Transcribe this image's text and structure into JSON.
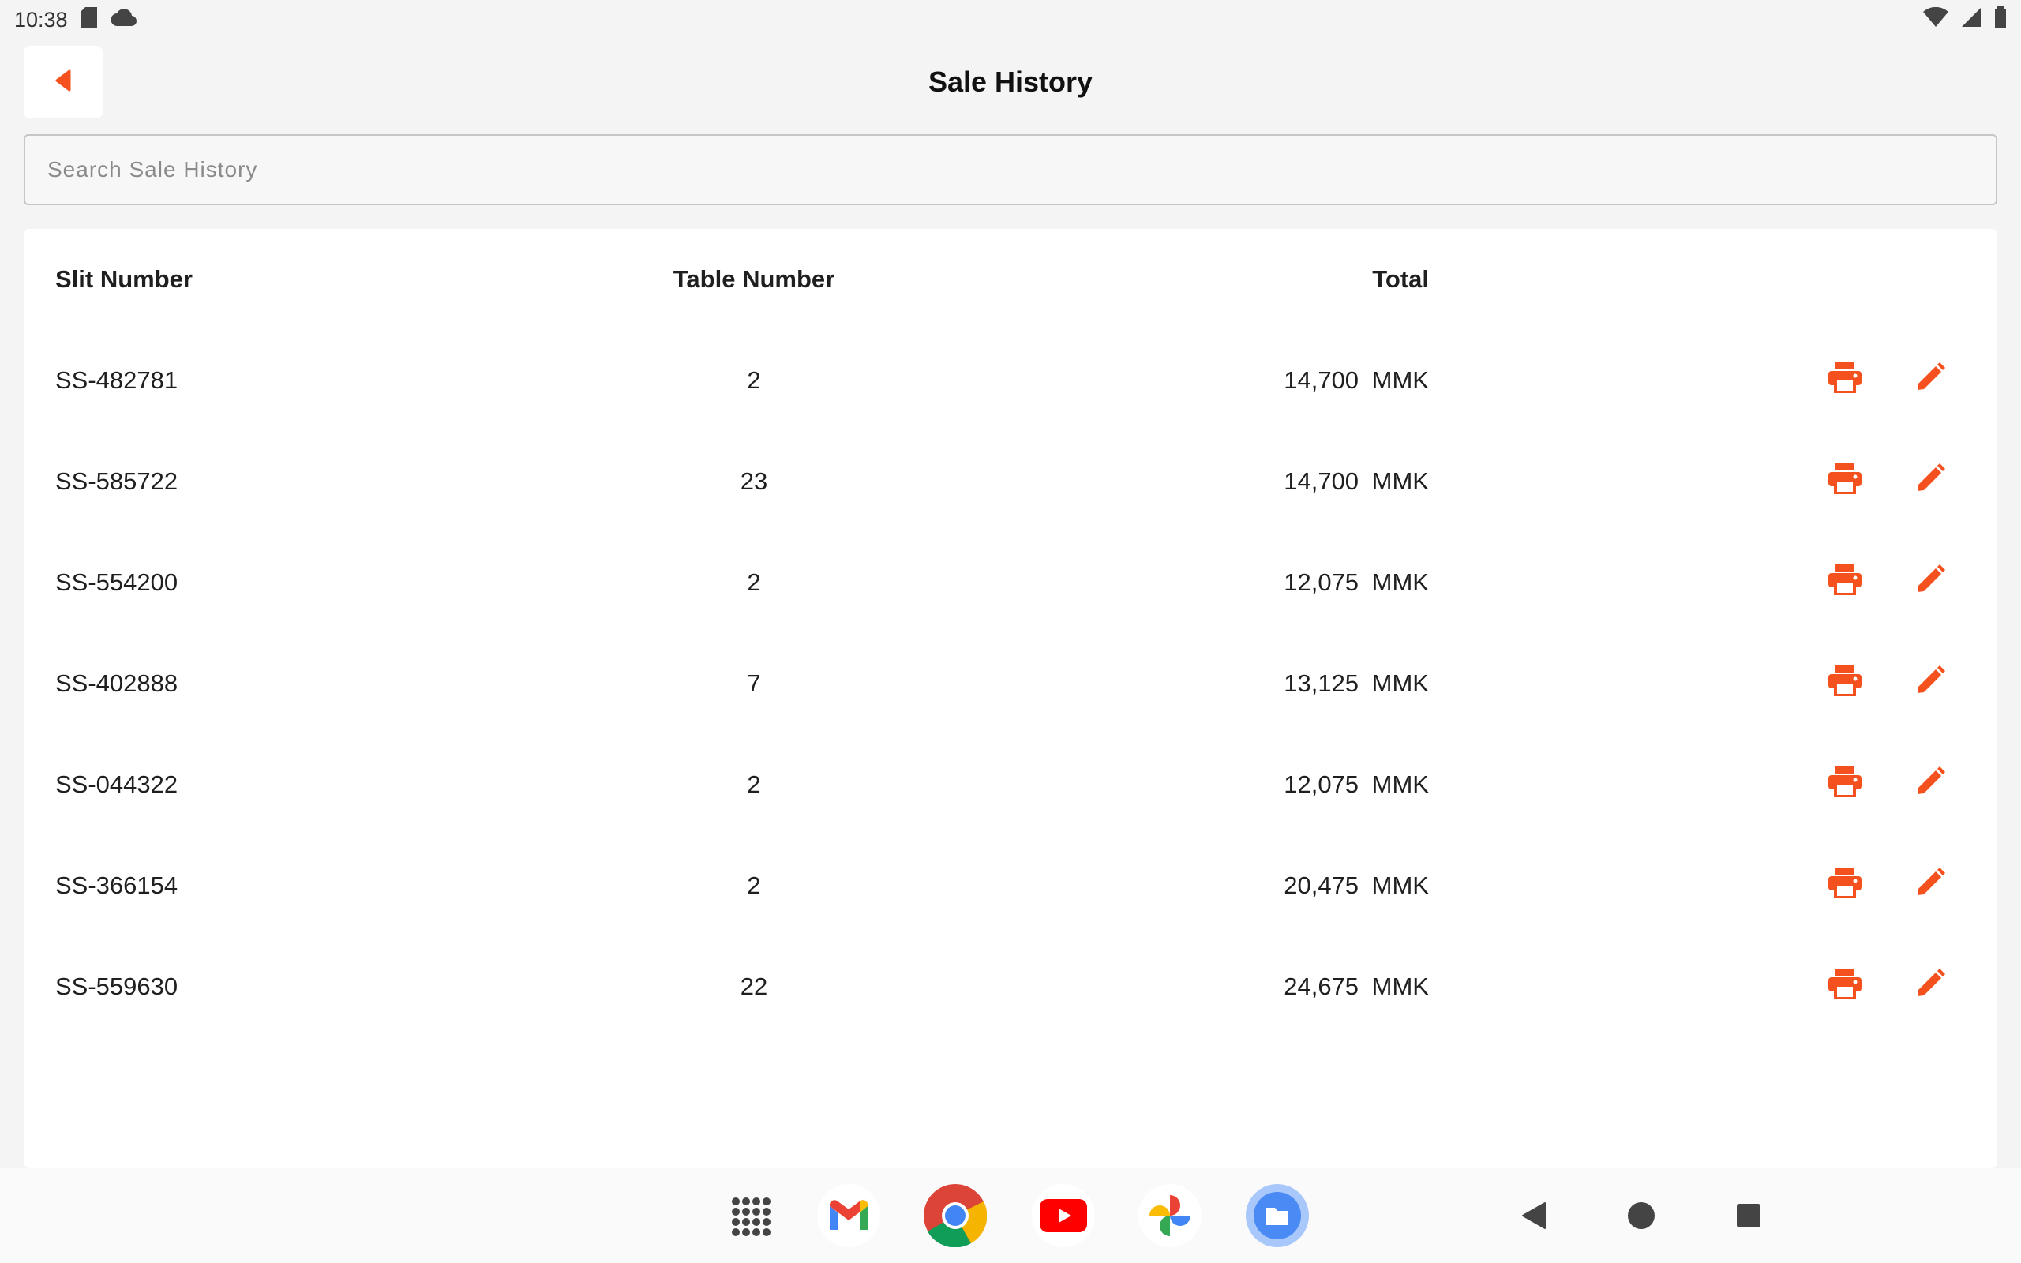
{
  "status_bar": {
    "time": "10:38"
  },
  "header": {
    "title": "Sale History",
    "back_icon": "back-arrow-icon"
  },
  "search": {
    "placeholder": "Search Sale History",
    "value": ""
  },
  "table": {
    "columns": [
      "Slit Number",
      "Table Number",
      "Total"
    ],
    "rows": [
      {
        "slit": "SS-482781",
        "table": "2",
        "total": "14,700 MMK"
      },
      {
        "slit": "SS-585722",
        "table": "23",
        "total": "14,700 MMK"
      },
      {
        "slit": "SS-554200",
        "table": "2",
        "total": "12,075 MMK"
      },
      {
        "slit": "SS-402888",
        "table": "7",
        "total": "13,125 MMK"
      },
      {
        "slit": "SS-044322",
        "table": "2",
        "total": "12,075 MMK"
      },
      {
        "slit": "SS-366154",
        "table": "2",
        "total": "20,475 MMK"
      },
      {
        "slit": "SS-559630",
        "table": "22",
        "total": "24,675 MMK"
      }
    ],
    "row_actions": [
      "print-icon",
      "edit-icon"
    ]
  },
  "dock": {
    "apps": [
      "app-drawer-icon",
      "gmail-icon",
      "chrome-icon",
      "youtube-icon",
      "photos-icon",
      "files-icon"
    ],
    "nav": [
      "nav-back-icon",
      "nav-home-icon",
      "nav-recents-icon"
    ]
  },
  "colors": {
    "accent": "#f4511e",
    "background": "#f4f4f4",
    "card": "#ffffff"
  }
}
